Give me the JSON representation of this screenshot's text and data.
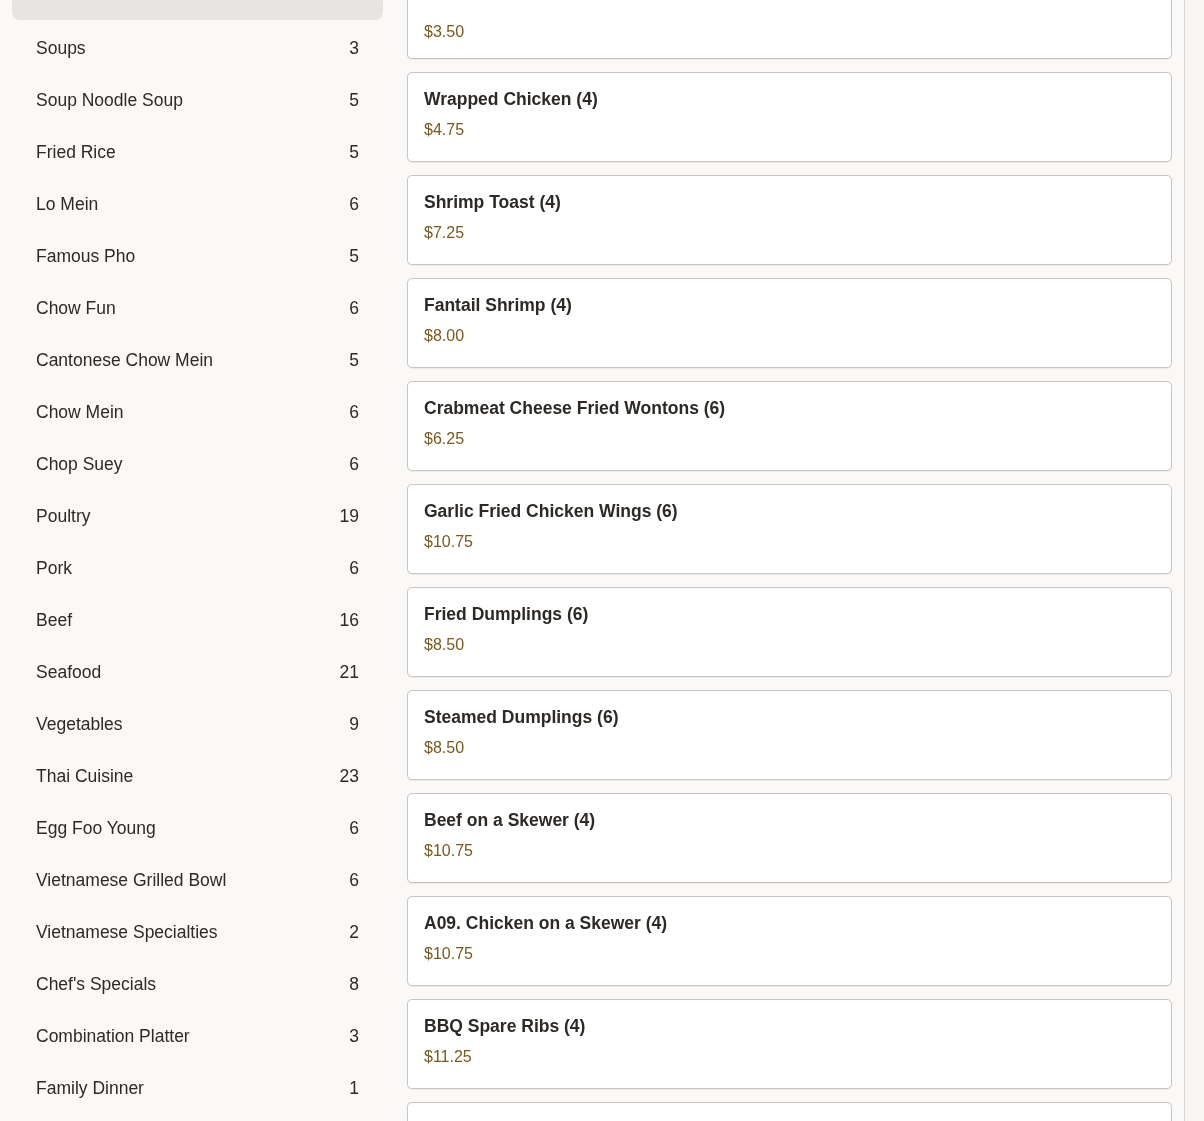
{
  "categories": [
    {
      "selected": true
    },
    {
      "label": "Soups",
      "count": "3",
      "selected": false
    },
    {
      "label": "Soup Noodle Soup",
      "count": "5",
      "selected": false
    },
    {
      "label": "Fried Rice",
      "count": "5",
      "selected": false
    },
    {
      "label": "Lo Mein",
      "count": "6",
      "selected": false
    },
    {
      "label": "Famous Pho",
      "count": "5",
      "selected": false
    },
    {
      "label": "Chow Fun",
      "count": "6",
      "selected": false
    },
    {
      "label": "Cantonese Chow Mein",
      "count": "5",
      "selected": false
    },
    {
      "label": "Chow Mein",
      "count": "6",
      "selected": false
    },
    {
      "label": "Chop Suey",
      "count": "6",
      "selected": false
    },
    {
      "label": "Poultry",
      "count": "19",
      "selected": false
    },
    {
      "label": "Pork",
      "count": "6",
      "selected": false
    },
    {
      "label": "Beef",
      "count": "16",
      "selected": false
    },
    {
      "label": "Seafood",
      "count": "21",
      "selected": false
    },
    {
      "label": "Vegetables",
      "count": "9",
      "selected": false
    },
    {
      "label": "Thai Cuisine",
      "count": "23",
      "selected": false
    },
    {
      "label": "Egg Foo Young",
      "count": "6",
      "selected": false
    },
    {
      "label": "Vietnamese Grilled Bowl",
      "count": "6",
      "selected": false
    },
    {
      "label": "Vietnamese Specialties",
      "count": "2",
      "selected": false
    },
    {
      "label": "Chef's Specials",
      "count": "8",
      "selected": false
    },
    {
      "label": "Combination Platter",
      "count": "3",
      "selected": false
    },
    {
      "label": "Family Dinner",
      "count": "1",
      "selected": false
    }
  ],
  "menu_items": [
    {
      "kind": "cut_top",
      "price": "$3.50"
    },
    {
      "name": "Wrapped Chicken (4)",
      "price": "$4.75"
    },
    {
      "name": "Shrimp Toast (4)",
      "price": "$7.25"
    },
    {
      "name": "Fantail Shrimp (4)",
      "price": "$8.00"
    },
    {
      "name": "Crabmeat Cheese Fried Wontons (6)",
      "price": "$6.25"
    },
    {
      "name": "Garlic Fried Chicken Wings (6)",
      "price": "$10.75"
    },
    {
      "name": "Fried Dumplings (6)",
      "price": "$8.50"
    },
    {
      "name": "Steamed Dumplings (6)",
      "price": "$8.50"
    },
    {
      "name": "Beef on a Skewer (4)",
      "price": "$10.75"
    },
    {
      "name": "A09. Chicken on a Skewer (4)",
      "price": "$10.75"
    },
    {
      "name": "BBQ Spare Ribs (4)",
      "price": "$11.25"
    },
    {
      "kind": "cut_bottom"
    }
  ]
}
